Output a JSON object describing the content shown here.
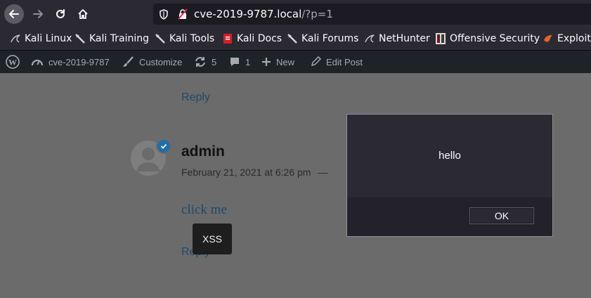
{
  "browser": {
    "url_host": "cve-2019-9787.local",
    "url_path": "/?p=1",
    "icons": [
      "back-icon",
      "forward-icon",
      "reload-icon",
      "home-icon",
      "shield-icon",
      "insecure-lock-icon"
    ]
  },
  "bookmarks": [
    {
      "label": "Kali Linux",
      "icon": "kali-dragon-icon"
    },
    {
      "label": "Kali Training",
      "icon": "kali-sword-icon"
    },
    {
      "label": "Kali Tools",
      "icon": "kali-sword-icon"
    },
    {
      "label": "Kali Docs",
      "icon": "kali-docs-icon"
    },
    {
      "label": "Kali Forums",
      "icon": "kali-sword-icon"
    },
    {
      "label": "NetHunter",
      "icon": "kali-dragon-icon"
    },
    {
      "label": "Offensive Security",
      "icon": "offsec-icon"
    },
    {
      "label": "Exploit-",
      "icon": "exploit-db-icon"
    }
  ],
  "adminbar": {
    "site": "cve-2019-9787",
    "customize": "Customize",
    "updates": "5",
    "comments": "1",
    "new": "New",
    "edit": "Edit Post"
  },
  "comment": {
    "reply_top": "Reply",
    "author": "admin",
    "date": "February 21, 2021 at 6:26 pm",
    "separator": "—",
    "body_link": "click me",
    "reply_bottom": "Reply",
    "xss_button": "XSS"
  },
  "dialog": {
    "message": "hello",
    "ok_label": "OK"
  },
  "colors": {
    "browser_chrome": "#2b2a33",
    "adminbar": "#1d2327",
    "overlay_content": "#6b6b6b",
    "link": "#1e4a6b"
  }
}
